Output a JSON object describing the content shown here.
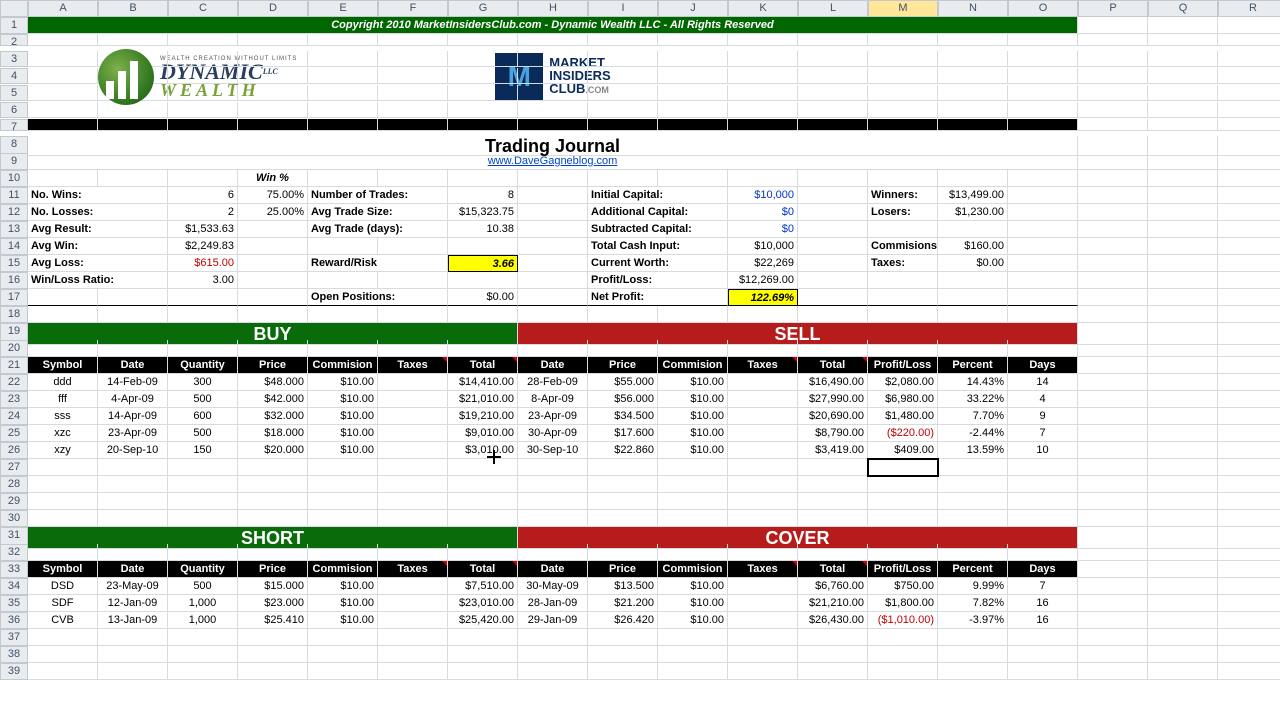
{
  "columns": [
    "A",
    "B",
    "C",
    "D",
    "E",
    "F",
    "G",
    "H",
    "I",
    "J",
    "K",
    "L",
    "M",
    "N",
    "O",
    "P",
    "Q",
    "R"
  ],
  "active_column": "M",
  "selected_cell": {
    "row": 27,
    "col": 13
  },
  "cursor_cell": {
    "row": 26,
    "col": 7
  },
  "copyright": "Copyright 2010 MarketInsidersClub.com - Dynamic Wealth LLC - All Rights Reserved",
  "title": "Trading Journal",
  "link": "www.DaveGagneblog.com",
  "logos": {
    "dw_top": "WEALTH CREATION WITHOUT LIMITS",
    "dw_main": "DYNAMIC",
    "dw_sub": "WEALTH",
    "dw_llc": "LLC",
    "mic_top": "MARKET",
    "mic_mid": "INSIDERS",
    "mic_bot": "CLUB",
    "mic_tld": ".COM"
  },
  "stats": {
    "win_pct_label": "Win %",
    "no_wins_label": "No. Wins:",
    "no_wins_val": "6",
    "no_wins_pct": "75.00%",
    "no_losses_label": "No. Losses:",
    "no_losses_val": "2",
    "no_losses_pct": "25.00%",
    "avg_result_label": "Avg Result:",
    "avg_result_val": "$1,533.63",
    "avg_win_label": "Avg Win:",
    "avg_win_val": "$2,249.83",
    "avg_loss_label": "Avg Loss:",
    "avg_loss_val": "$615.00",
    "wl_ratio_label": "Win/Loss Ratio:",
    "wl_ratio_val": "3.00",
    "num_trades_label": "Number of Trades:",
    "num_trades_val": "8",
    "avg_trade_size_label": "Avg Trade Size:",
    "avg_trade_size_val": "$15,323.75",
    "avg_trade_days_label": "Avg Trade (days):",
    "avg_trade_days_val": "10.38",
    "reward_risk_label": "Reward/Risk",
    "reward_risk_val": "3.66",
    "open_positions_label": "Open Positions:",
    "open_positions_val": "$0.00",
    "init_cap_label": "Initial Capital:",
    "init_cap_val": "$10,000",
    "add_cap_label": "Additional Capital:",
    "add_cap_val": "$0",
    "sub_cap_label": "Subtracted Capital:",
    "sub_cap_val": "$0",
    "cash_input_label": "Total Cash Input:",
    "cash_input_val": "$10,000",
    "cur_worth_label": "Current Worth:",
    "cur_worth_val": "$22,269",
    "pl_label": "Profit/Loss:",
    "pl_val": "$12,269.00",
    "net_profit_label": "Net Profit:",
    "net_profit_val": "122.69%",
    "winners_label": "Winners:",
    "winners_val": "$13,499.00",
    "losers_label": "Losers:",
    "losers_val": "$1,230.00",
    "commissions_label": "Commisions",
    "commissions_val": "$160.00",
    "taxes_label": "Taxes:",
    "taxes_val": "$0.00"
  },
  "sections": {
    "buy": "BUY",
    "sell": "SELL",
    "short": "SHORT",
    "cover": "COVER"
  },
  "headers": {
    "symbol": "Symbol",
    "date": "Date",
    "quantity": "Quantity",
    "price": "Price",
    "commission": "Commision",
    "taxes": "Taxes",
    "total": "Total",
    "pl": "Profit/Loss",
    "percent": "Percent",
    "days": "Days"
  },
  "trades": [
    {
      "sym": "ddd",
      "bdate": "14-Feb-09",
      "qty": "300",
      "bprice": "$48.000",
      "bcomm": "$10.00",
      "btotal": "$14,410.00",
      "sdate": "28-Feb-09",
      "sprice": "$55.000",
      "scomm": "$10.00",
      "stotal": "$16,490.00",
      "pl": "$2,080.00",
      "pct": "14.43%",
      "days": "14",
      "neg": false
    },
    {
      "sym": "fff",
      "bdate": "4-Apr-09",
      "qty": "500",
      "bprice": "$42.000",
      "bcomm": "$10.00",
      "btotal": "$21,010.00",
      "sdate": "8-Apr-09",
      "sprice": "$56.000",
      "scomm": "$10.00",
      "stotal": "$27,990.00",
      "pl": "$6,980.00",
      "pct": "33.22%",
      "days": "4",
      "neg": false
    },
    {
      "sym": "sss",
      "bdate": "14-Apr-09",
      "qty": "600",
      "bprice": "$32.000",
      "bcomm": "$10.00",
      "btotal": "$19,210.00",
      "sdate": "23-Apr-09",
      "sprice": "$34.500",
      "scomm": "$10.00",
      "stotal": "$20,690.00",
      "pl": "$1,480.00",
      "pct": "7.70%",
      "days": "9",
      "neg": false
    },
    {
      "sym": "xzc",
      "bdate": "23-Apr-09",
      "qty": "500",
      "bprice": "$18.000",
      "bcomm": "$10.00",
      "btotal": "$9,010.00",
      "sdate": "30-Apr-09",
      "sprice": "$17.600",
      "scomm": "$10.00",
      "stotal": "$8,790.00",
      "pl": "($220.00)",
      "pct": "-2.44%",
      "days": "7",
      "neg": true
    },
    {
      "sym": "xzy",
      "bdate": "20-Sep-10",
      "qty": "150",
      "bprice": "$20.000",
      "bcomm": "$10.00",
      "btotal": "$3,010.00",
      "sdate": "30-Sep-10",
      "sprice": "$22.860",
      "scomm": "$10.00",
      "stotal": "$3,419.00",
      "pl": "$409.00",
      "pct": "13.59%",
      "days": "10",
      "neg": false
    }
  ],
  "shorts": [
    {
      "sym": "DSD",
      "bdate": "23-May-09",
      "qty": "500",
      "bprice": "$15.000",
      "bcomm": "$10.00",
      "btotal": "$7,510.00",
      "sdate": "30-May-09",
      "sprice": "$13.500",
      "scomm": "$10.00",
      "stotal": "$6,760.00",
      "pl": "$750.00",
      "pct": "9.99%",
      "days": "7",
      "neg": false
    },
    {
      "sym": "SDF",
      "bdate": "12-Jan-09",
      "qty": "1,000",
      "bprice": "$23.000",
      "bcomm": "$10.00",
      "btotal": "$23,010.00",
      "sdate": "28-Jan-09",
      "sprice": "$21.200",
      "scomm": "$10.00",
      "stotal": "$21,210.00",
      "pl": "$1,800.00",
      "pct": "7.82%",
      "days": "16",
      "neg": false
    },
    {
      "sym": "CVB",
      "bdate": "13-Jan-09",
      "qty": "1,000",
      "bprice": "$25.410",
      "bcomm": "$10.00",
      "btotal": "$25,420.00",
      "sdate": "29-Jan-09",
      "sprice": "$26.420",
      "scomm": "$10.00",
      "stotal": "$26,430.00",
      "pl": "($1,010.00)",
      "pct": "-3.97%",
      "days": "16",
      "neg": true
    }
  ]
}
